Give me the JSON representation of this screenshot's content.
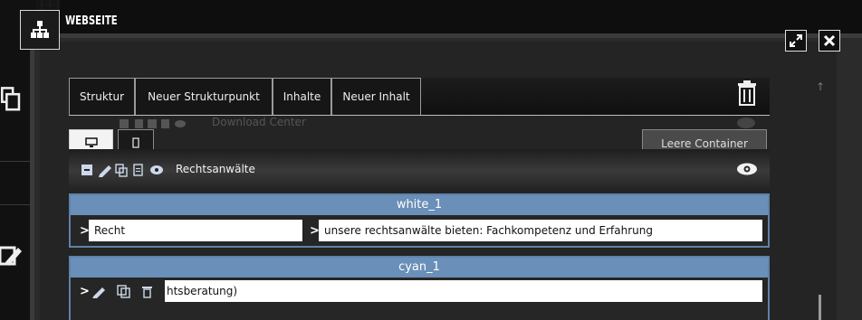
{
  "header": {
    "title": "WEBSEITE",
    "logo_icon": "sitemap-icon"
  },
  "window": {
    "expand_icon": "expand-icon",
    "close_icon": "close-icon"
  },
  "tabs": [
    {
      "label": "Struktur"
    },
    {
      "label": "Neuer Strukturpunkt"
    },
    {
      "label": "Inhalte"
    },
    {
      "label": "Neuer Inhalt"
    }
  ],
  "ghost_item": {
    "label": "Download Center"
  },
  "device_buttons": [
    {
      "icon": "desktop-icon"
    },
    {
      "icon": "mobile-icon"
    }
  ],
  "leere_container_label": "Leere Container",
  "structure_item": {
    "label": "Rechtsanwälte"
  },
  "containers": [
    {
      "name": "white_1",
      "fields": [
        "Recht",
        "unsere rechtsanwälte bieten: Fachkompetenz und Erfahrung"
      ]
    },
    {
      "name": "cyan_1",
      "fields": [
        "htsberatung)"
      ]
    }
  ],
  "colors": {
    "container_header": "#6a8fb8",
    "container_border": "#5f82a9",
    "background": "#0b0b0b"
  }
}
